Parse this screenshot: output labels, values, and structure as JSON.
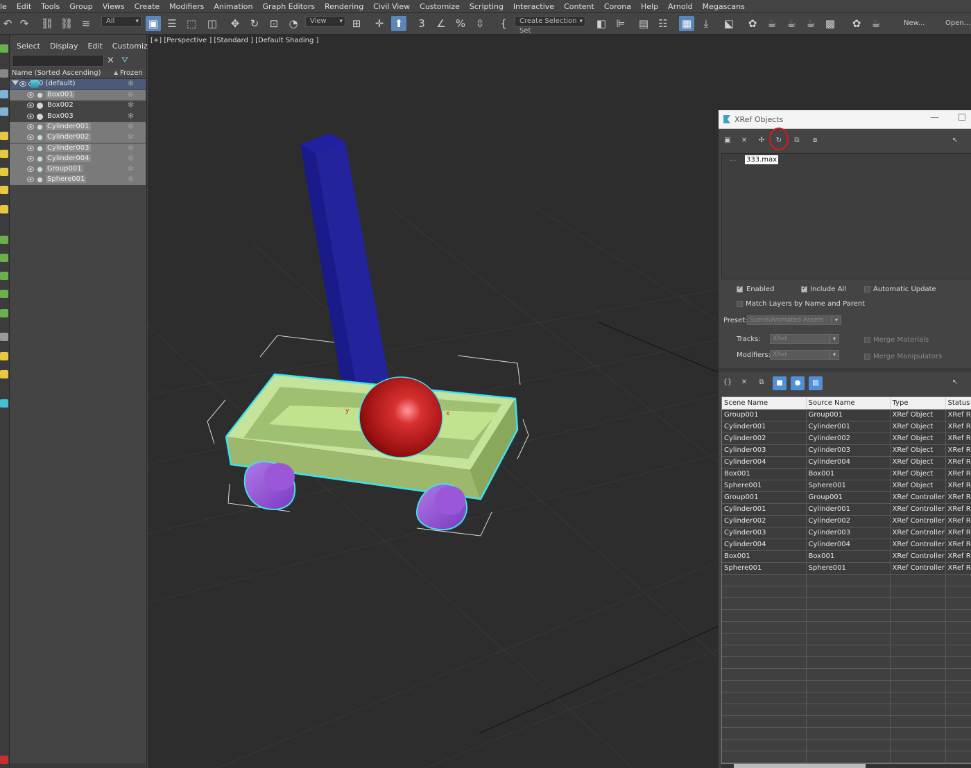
{
  "menu": [
    "le",
    "Edit",
    "Tools",
    "Group",
    "Views",
    "Create",
    "Modifiers",
    "Animation",
    "Graph Editors",
    "Rendering",
    "Civil View",
    "Customize",
    "Scripting",
    "Interactive",
    "Content",
    "Corona",
    "Help",
    "Arnold",
    "Megascans"
  ],
  "toolbar": {
    "filter_value": "All",
    "refcoord_value": "View",
    "selection_set_placeholder": "Create Selection Set",
    "new_label": "New...",
    "open_label": "Open..."
  },
  "explorer": {
    "tabs": [
      "Select",
      "Display",
      "Edit",
      "Customize"
    ],
    "col_name": "Name (Sorted Ascending)",
    "col_frozen": "Frozen",
    "layer_name": "0 (default)",
    "items": [
      {
        "name": "Box001",
        "selected": true,
        "xref": true
      },
      {
        "name": "Box002",
        "selected": false,
        "xref": false
      },
      {
        "name": "Box003",
        "selected": false,
        "xref": false
      },
      {
        "name": "Cylinder001",
        "selected": true,
        "xref": true
      },
      {
        "name": "Cylinder002",
        "selected": true,
        "xref": true
      },
      {
        "name": "Cylinder003",
        "selected": true,
        "xref": true
      },
      {
        "name": "Cylinder004",
        "selected": true,
        "xref": true
      },
      {
        "name": "Group001",
        "selected": true,
        "xref": true
      },
      {
        "name": "Sphere001",
        "selected": true,
        "xref": true
      }
    ]
  },
  "viewport": {
    "label": "[+] [Perspective ] [Standard ] [Default Shading ]"
  },
  "xref": {
    "title": "XRef Objects",
    "file": "333.max",
    "enabled_label": "Enabled",
    "include_all_label": "Include All",
    "auto_update_label": "Automatic Update",
    "match_layers_label": "Match Layers by Name and Parent",
    "preset_label": "Preset:",
    "preset_value": "Scene/Animated Assets",
    "tracks_label": "Tracks:",
    "tracks_value": "XRef",
    "modifiers_label": "Modifiers:",
    "modifiers_value": "XRef",
    "merge_materials_label": "Merge Materials",
    "merge_manipulators_label": "Merge Manipulators",
    "columns": [
      "Scene Name",
      "Source Name",
      "Type",
      "Status"
    ],
    "rows": [
      [
        "Group001",
        "Group001",
        "XRef Object",
        "XRef Re"
      ],
      [
        "Cylinder001",
        "Cylinder001",
        "XRef Object",
        "XRef Re"
      ],
      [
        "Cylinder002",
        "Cylinder002",
        "XRef Object",
        "XRef Re"
      ],
      [
        "Cylinder003",
        "Cylinder003",
        "XRef Object",
        "XRef Re"
      ],
      [
        "Cylinder004",
        "Cylinder004",
        "XRef Object",
        "XRef Re"
      ],
      [
        "Box001",
        "Box001",
        "XRef Object",
        "XRef Re"
      ],
      [
        "Sphere001",
        "Sphere001",
        "XRef Object",
        "XRef Re"
      ],
      [
        "Group001",
        "Group001",
        "XRef Controller",
        "XRef Re"
      ],
      [
        "Cylinder001",
        "Cylinder001",
        "XRef Controller",
        "XRef Re"
      ],
      [
        "Cylinder002",
        "Cylinder002",
        "XRef Controller",
        "XRef Re"
      ],
      [
        "Cylinder003",
        "Cylinder003",
        "XRef Controller",
        "XRef Re"
      ],
      [
        "Cylinder004",
        "Cylinder004",
        "XRef Controller",
        "XRef Re"
      ],
      [
        "Box001",
        "Box001",
        "XRef Controller",
        "XRef Re"
      ],
      [
        "Sphere001",
        "Sphere001",
        "XRef Controller",
        "XRef Re"
      ]
    ]
  },
  "colors": {
    "accent": "#5b86b8",
    "selection_outline": "#40e0f0",
    "highlight_circle": "#e01818",
    "box_color": "#a8d080",
    "handle_color": "#1c1c9c",
    "sphere_color": "#c01818",
    "wheel_color": "#8a40c8"
  }
}
